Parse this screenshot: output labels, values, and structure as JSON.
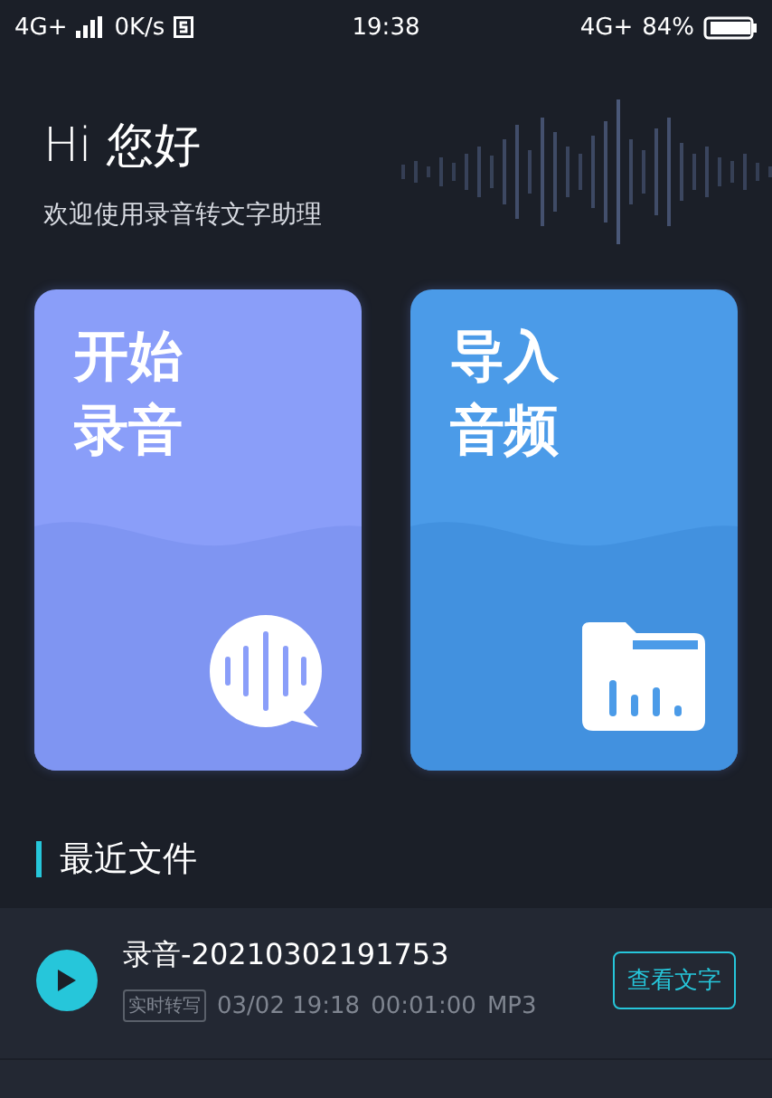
{
  "status_bar": {
    "network": "4G+",
    "speed": "0K/s",
    "time": "19:38",
    "network_right": "4G+",
    "battery": "84%"
  },
  "greeting": {
    "title": "Hi 您好",
    "subtitle": "欢迎使用录音转文字助理"
  },
  "actions": [
    {
      "kind": "record",
      "lines": [
        "开始",
        "录音"
      ]
    },
    {
      "kind": "import",
      "lines": [
        "导入",
        "音频"
      ]
    }
  ],
  "recent": {
    "title": "最近文件",
    "files": [
      {
        "name": "录音-20210302191753",
        "tag": "实时转写",
        "date": "03/02 19:18",
        "duration": "00:01:00",
        "format": "MP3",
        "action": "查看文字"
      }
    ]
  }
}
